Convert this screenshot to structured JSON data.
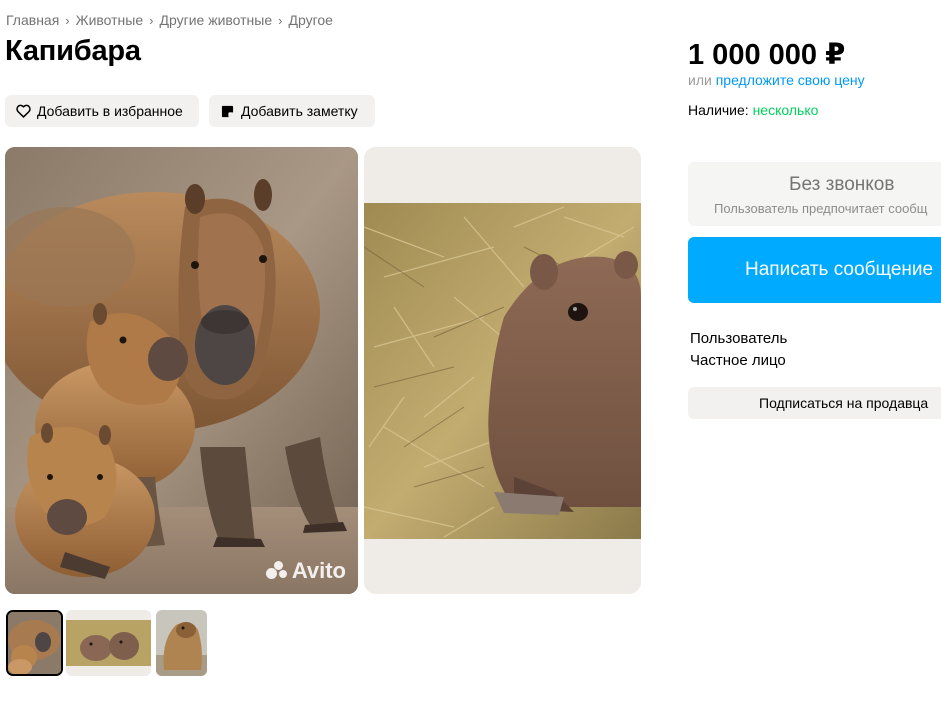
{
  "breadcrumb": {
    "items": [
      "Главная",
      "Животные",
      "Другие животные",
      "Другое"
    ],
    "separator": "›"
  },
  "listing": {
    "title": "Капибара",
    "favorite_label": "Добавить в избранное",
    "note_label": "Добавить заметку"
  },
  "gallery": {
    "watermark": "Avito",
    "selected_thumb_index": 0,
    "thumb_count": 3
  },
  "pricing": {
    "price": "1 000 000 ₽",
    "offer_prefix": "или",
    "offer_link": "предложите свою цену",
    "availability_label": "Наличие:",
    "availability_value": "несколько"
  },
  "contact": {
    "no_calls_title": "Без звонков",
    "no_calls_sub": "Пользователь предпочитает сообщ",
    "message_button": "Написать сообщение"
  },
  "seller": {
    "name": "Пользователь",
    "type": "Частное лицо",
    "subscribe_label": "Подписаться на продавца"
  },
  "icons": {
    "favorite": "heart-icon",
    "note": "note-icon",
    "breadcrumb_sep": "chevron-right-icon"
  },
  "colors": {
    "link": "#0099f7",
    "accent_button": "#00aaff",
    "availability": "#02d15c",
    "muted_text": "#737373",
    "button_bg": "#f2f1f0"
  }
}
